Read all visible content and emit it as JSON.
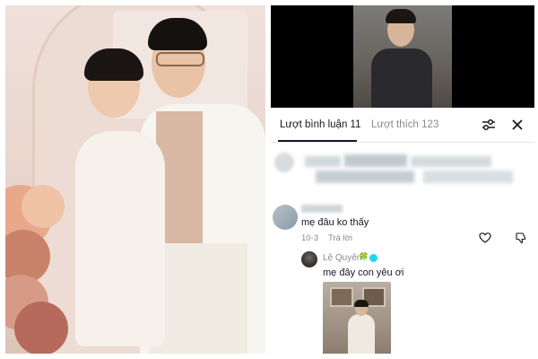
{
  "tabs": {
    "comments_label": "Lượt bình luận 11",
    "likes_label": "Lượt thích 123"
  },
  "icons": {
    "filter": "sliders-icon",
    "close": "close-icon",
    "heart": "heart-icon",
    "dislike": "thumbs-down-icon",
    "verified": "verified-badge-icon"
  },
  "comments": [
    {
      "text": "mẹ đâu ko thấy",
      "date": "10-3",
      "reply_label": "Trả lời"
    }
  ],
  "reply": {
    "username": "Lệ Quyên",
    "emoji": "🍀",
    "text": "mẹ đây con yêu ơi"
  },
  "colors": {
    "text_primary": "#161823",
    "text_secondary": "#8a8a8a",
    "verified": "#20d5ec",
    "video_bg": "#000000"
  }
}
